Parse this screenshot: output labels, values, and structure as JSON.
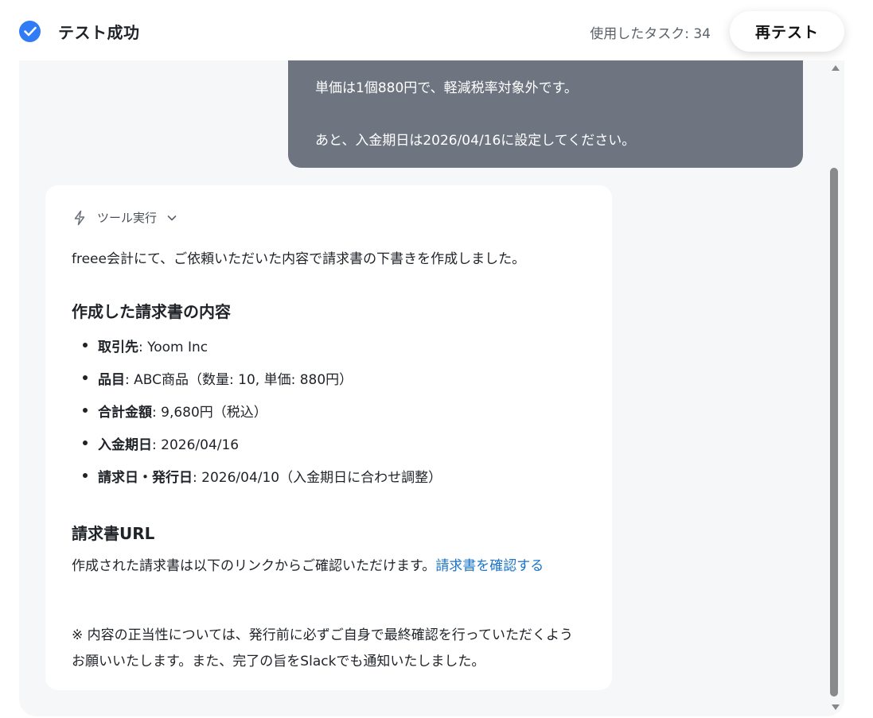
{
  "header": {
    "status_title": "テスト成功",
    "task_count": "使用したタスク: 34",
    "retest_label": "再テスト"
  },
  "user_message": {
    "line_1": "単価は1個880円で、軽減税率対象外です。",
    "line_2": "あと、入金期日は2026/04/16に設定してください。"
  },
  "assistant": {
    "tool_label": "ツール実行",
    "intro": "freee会計にて、ご依頼いただいた内容で請求書の下書きを作成しました。",
    "heading_details": "作成した請求書の内容",
    "details": [
      {
        "key": "取引先",
        "value": ": Yoom Inc"
      },
      {
        "key": "品目",
        "value": ": ABC商品（数量: 10, 単価: 880円）"
      },
      {
        "key": "合計金額",
        "value": ": 9,680円（税込）"
      },
      {
        "key": "入金期日",
        "value": ": 2026/04/16"
      },
      {
        "key": "請求日・発行日",
        "value": ": 2026/04/10（入金期日に合わせ調整）"
      }
    ],
    "heading_url": "請求書URL",
    "url_text": "作成された請求書は以下のリンクからご確認いただけます。",
    "url_link": "請求書を確認する",
    "note": "※ 内容の正当性については、発行前に必ずご自身で最終確認を行っていただくようお願いいたします。また、完了の旨をSlackでも通知いたしました。"
  },
  "colors": {
    "accent": "#2f7cf6",
    "link": "#1a73c8",
    "user_bubble": "#6e7580",
    "panel_bg": "#f6f7f9"
  }
}
